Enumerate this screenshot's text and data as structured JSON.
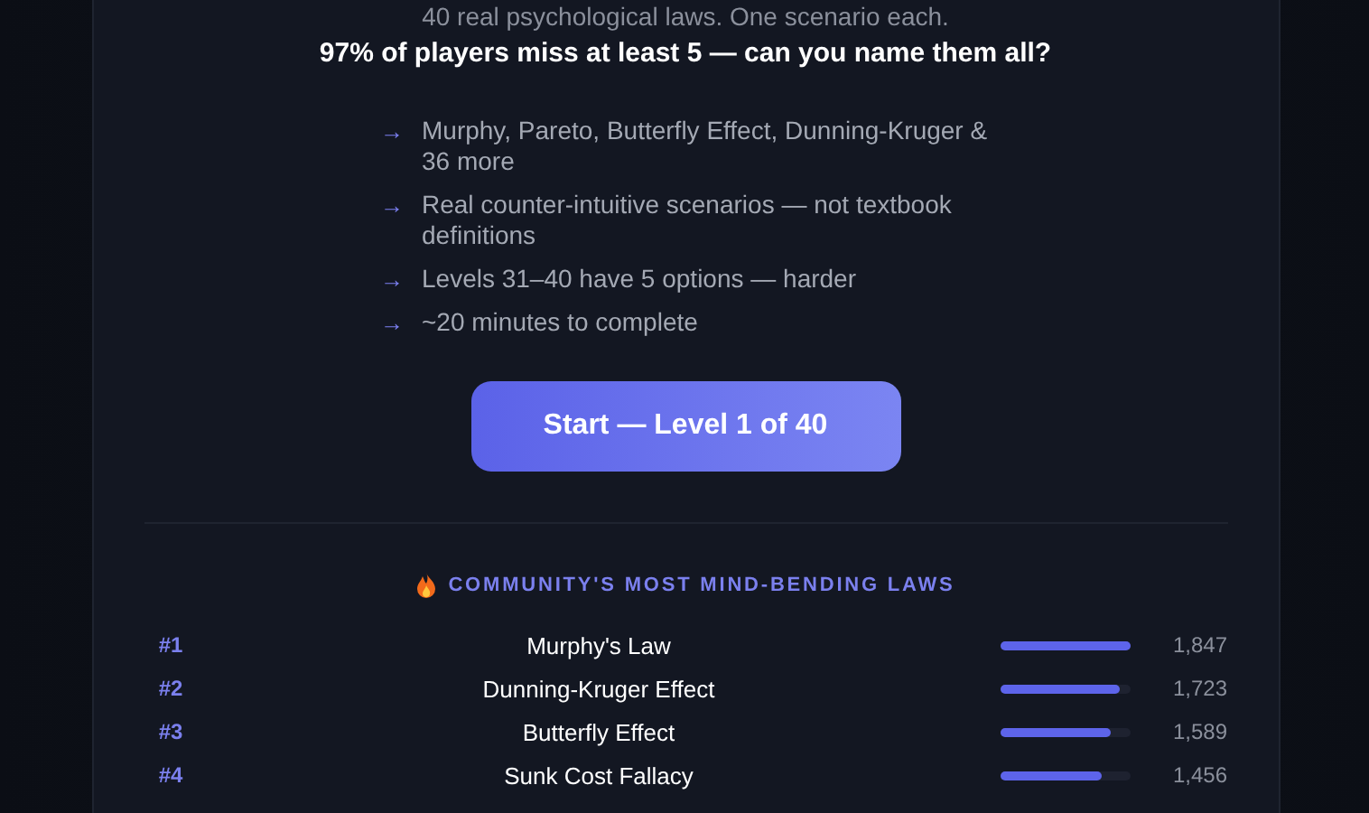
{
  "intro": {
    "subtitle": "40 real psychological laws. One scenario each.",
    "headline": "97% of players miss at least 5 — can you name them all?"
  },
  "features": [
    {
      "icon": "→",
      "text": "Murphy, Pareto, Butterfly Effect, Dunning-Kruger & 36 more"
    },
    {
      "icon": "→",
      "text": "Real counter-intuitive scenarios — not textbook definitions"
    },
    {
      "icon": "→",
      "text": "Levels 31–40 have 5 options — harder"
    },
    {
      "icon": "→",
      "text": "~20 minutes to complete"
    }
  ],
  "start_button": "Start — Level 1 of 40",
  "leaderboard": {
    "title": "COMMUNITY'S MOST MIND-BENDING LAWS",
    "rows": [
      {
        "rank": "#1",
        "name": "Murphy's Law",
        "level": 1.0,
        "count": "1,847"
      },
      {
        "rank": "#2",
        "name": "Dunning-Kruger Effect",
        "level": 0.93,
        "count": "1,723"
      },
      {
        "rank": "#3",
        "name": "Butterfly Effect",
        "level": 0.86,
        "count": "1,589"
      },
      {
        "rank": "#4",
        "name": "Sunk Cost Fallacy",
        "level": 0.79,
        "count": "1,456"
      }
    ]
  }
}
